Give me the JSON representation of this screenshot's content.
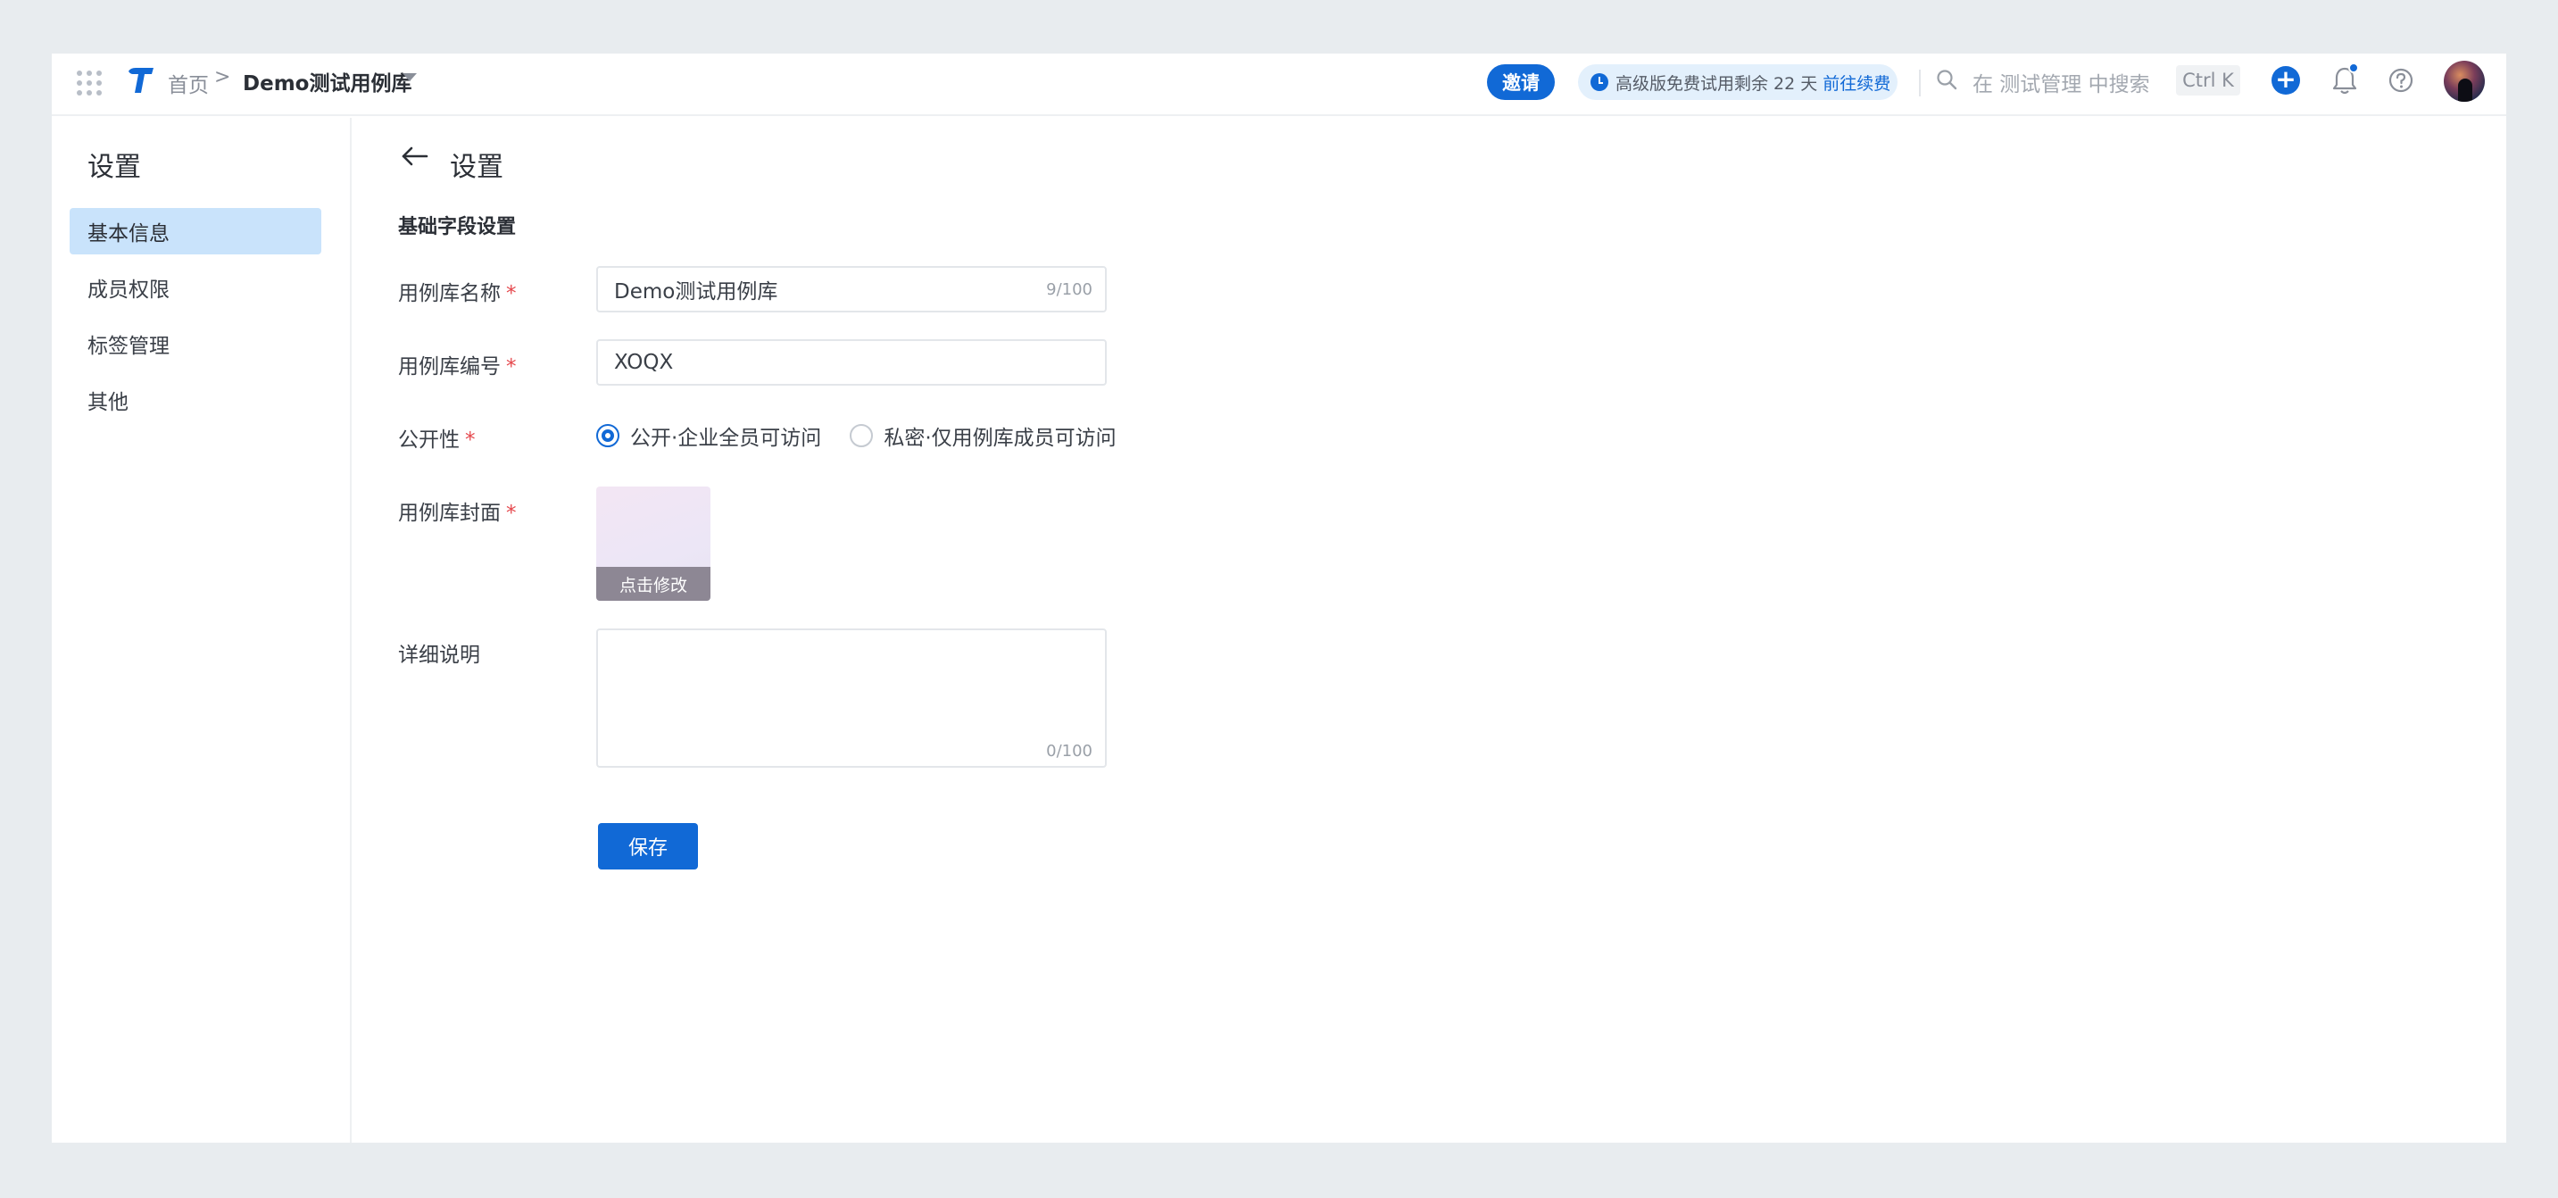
{
  "header": {
    "breadcrumb_home": "首页",
    "breadcrumb_sep": ">",
    "breadcrumb_current": "Demo测试用例库",
    "invite_label": "邀请",
    "trial_text": "高级版免费试用剩余 22 天",
    "trial_link": "前往续费",
    "search_placeholder": "在 测试管理 中搜索",
    "search_shortcut": "Ctrl K",
    "add_label": "+",
    "icons": [
      "apps-grid-icon",
      "logo-icon",
      "chevron-down-icon",
      "clock-icon",
      "search-icon",
      "plus-icon",
      "bell-icon",
      "help-icon",
      "avatar"
    ]
  },
  "sidebar": {
    "title": "设置",
    "items": [
      {
        "label": "基本信息",
        "active": true
      },
      {
        "label": "成员权限",
        "active": false
      },
      {
        "label": "标签管理",
        "active": false
      },
      {
        "label": "其他",
        "active": false
      }
    ]
  },
  "main": {
    "title": "设置",
    "section_title": "基础字段设置",
    "required_mark": "*",
    "fields": {
      "name": {
        "label": "用例库名称",
        "value": "Demo测试用例库",
        "counter": "9/100"
      },
      "code": {
        "label": "用例库编号",
        "value": "XOQX"
      },
      "visibility": {
        "label": "公开性",
        "options": [
          {
            "label": "公开·企业全员可访问",
            "selected": true
          },
          {
            "label": "私密·仅用例库成员可访问",
            "selected": false
          }
        ]
      },
      "cover": {
        "label": "用例库封面",
        "action": "点击修改"
      },
      "description": {
        "label": "详细说明",
        "value": "",
        "counter": "0/100"
      }
    },
    "save_label": "保存"
  },
  "colors": {
    "primary": "#1169d6",
    "active_nav_bg": "#c9e3fb",
    "required": "#e5484d",
    "page_bg": "#e8ecef"
  }
}
